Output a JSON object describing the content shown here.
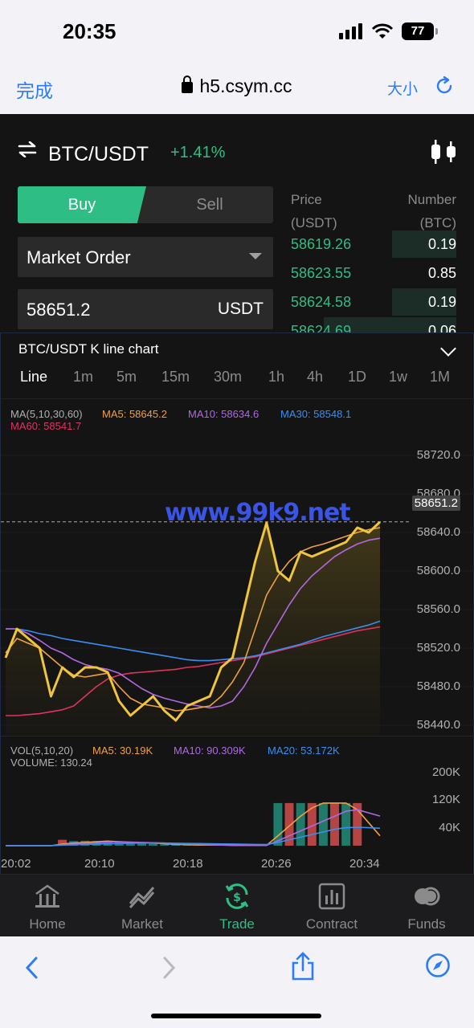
{
  "status_bar": {
    "time": "20:35",
    "battery": "77"
  },
  "browser": {
    "done_label": "完成",
    "url": "h5.csym.cc",
    "text_size_label": "大小"
  },
  "pair": {
    "name": "BTC/USDT",
    "change": "+1.41%"
  },
  "trade_form": {
    "buy_label": "Buy",
    "sell_label": "Sell",
    "order_type": "Market Order",
    "price_value": "58651.2",
    "price_unit": "USDT"
  },
  "order_book": {
    "price_header": "Price",
    "price_unit": "(USDT)",
    "number_header": "Number",
    "number_unit": "(BTC)",
    "rows": [
      {
        "price": "58619.26",
        "number": "0.19",
        "depth": 0.39
      },
      {
        "price": "58623.55",
        "number": "0.85",
        "depth": 0.0
      },
      {
        "price": "58624.58",
        "number": "0.19",
        "depth": 0.39
      },
      {
        "price": "58624.69",
        "number": "0.06",
        "depth": 0.8
      }
    ]
  },
  "chart_panel": {
    "title": "BTC/USDT K line chart",
    "periods": [
      "Line",
      "1m",
      "5m",
      "15m",
      "30m",
      "1h",
      "4h",
      "1D",
      "1w",
      "1M"
    ],
    "active_period": "Line",
    "ma_legend": {
      "label": "MA(5,10,30,60)",
      "ma5": "MA5: 58645.2",
      "ma10": "MA10: 58634.6",
      "ma30": "MA30: 58548.1",
      "ma60": "MA60: 58541.7"
    },
    "y_labels": [
      "58720.0",
      "58680.0",
      "58640.0",
      "58600.0",
      "58560.0",
      "58520.0",
      "58480.0",
      "58440.0"
    ],
    "last_price_tag": "58651.2",
    "watermark": "www.99k9.net",
    "vol_legend": {
      "label": "VOL(5,10,20)",
      "ma5": "MA5: 30.19K",
      "ma10": "MA10: 90.309K",
      "ma20": "MA20: 53.172K",
      "volume": "VOLUME: 130.24"
    },
    "vol_y_labels": [
      "200K",
      "120K",
      "40K"
    ],
    "time_labels": [
      "20:02",
      "20:10",
      "20:18",
      "20:26",
      "20:34"
    ]
  },
  "colors": {
    "up": "#2ebd85",
    "down": "#c94a4a",
    "price_line": "#f0c43c",
    "ma5": "#f0a040",
    "ma10": "#b069e0",
    "ma30": "#3a8ef0",
    "ma60": "#e0335f"
  },
  "chart_data": {
    "type": "line",
    "x": [
      "20:02",
      "20:03",
      "20:04",
      "20:05",
      "20:06",
      "20:07",
      "20:08",
      "20:09",
      "20:10",
      "20:11",
      "20:12",
      "20:13",
      "20:14",
      "20:15",
      "20:16",
      "20:17",
      "20:18",
      "20:19",
      "20:20",
      "20:21",
      "20:22",
      "20:23",
      "20:24",
      "20:25",
      "20:26",
      "20:27",
      "20:28",
      "20:29",
      "20:30",
      "20:31",
      "20:32",
      "20:33",
      "20:34",
      "20:35"
    ],
    "ylim": [
      58420,
      58740
    ],
    "series": [
      {
        "name": "price",
        "values": [
          58510,
          58540,
          58530,
          58520,
          58470,
          58500,
          58490,
          58500,
          58500,
          58495,
          58465,
          58450,
          58460,
          58470,
          58455,
          58445,
          58460,
          58465,
          58470,
          58500,
          58510,
          58560,
          58610,
          58650,
          58600,
          58590,
          58620,
          58615,
          58620,
          58625,
          58630,
          58645,
          58640,
          58651
        ]
      },
      {
        "name": "MA5",
        "values": [
          58515,
          58530,
          58525,
          58520,
          58510,
          58500,
          58492,
          58490,
          58492,
          58494,
          58480,
          58468,
          58462,
          58460,
          58458,
          58455,
          58456,
          58458,
          58460,
          58470,
          58485,
          58505,
          58540,
          58575,
          58595,
          58610,
          58620,
          58625,
          58628,
          58632,
          58636,
          58640,
          58643,
          58645
        ]
      },
      {
        "name": "MA10",
        "values": [
          58540,
          58540,
          58535,
          58528,
          58520,
          58515,
          58508,
          58503,
          58500,
          58498,
          58494,
          58486,
          58478,
          58472,
          58468,
          58465,
          58462,
          58460,
          58458,
          58460,
          58465,
          58480,
          58500,
          58525,
          58545,
          58565,
          58582,
          58595,
          58605,
          58615,
          58622,
          58628,
          58632,
          58634
        ]
      },
      {
        "name": "MA30",
        "values": [
          58540,
          58540,
          58538,
          58535,
          58533,
          58530,
          58528,
          58526,
          58524,
          58522,
          58520,
          58518,
          58516,
          58514,
          58512,
          58510,
          58508,
          58507,
          58507,
          58508,
          58509,
          58510,
          58512,
          58515,
          58518,
          58521,
          58524,
          58528,
          58532,
          58535,
          58538,
          58541,
          58544,
          58548
        ]
      },
      {
        "name": "MA60",
        "values": [
          58450,
          58450,
          58451,
          58452,
          58454,
          58456,
          58460,
          58470,
          58480,
          58488,
          58492,
          58494,
          58495,
          58496,
          58497,
          58498,
          58500,
          58501,
          58503,
          58505,
          58507,
          58509,
          58511,
          58514,
          58517,
          58520,
          58523,
          58526,
          58529,
          58532,
          58535,
          58538,
          58540,
          58542
        ]
      }
    ],
    "volume": {
      "ylim": [
        0,
        240000
      ],
      "values": [
        0,
        0,
        0,
        0,
        0,
        18000,
        14000,
        15000,
        14000,
        13000,
        10000,
        9000,
        8000,
        6000,
        4000,
        3000,
        2000,
        2000,
        1000,
        1000,
        1000,
        1000,
        0,
        0,
        130000,
        130000,
        130000,
        130000,
        130000,
        130000,
        130000,
        130000,
        0,
        0
      ],
      "up": [
        true,
        true,
        true,
        true,
        true,
        false,
        true,
        true,
        true,
        true,
        true,
        true,
        true,
        true,
        true,
        true,
        true,
        true,
        true,
        true,
        true,
        true,
        true,
        true,
        true,
        false,
        true,
        false,
        true,
        false,
        true,
        false,
        true,
        true
      ],
      "ma5": [
        0,
        0,
        0,
        0,
        0,
        5000,
        8000,
        10000,
        12000,
        14000,
        12000,
        10000,
        9000,
        8000,
        6000,
        4000,
        3000,
        2000,
        2000,
        2000,
        1000,
        1000,
        1000,
        1000,
        30000,
        60000,
        90000,
        115000,
        130000,
        130000,
        130000,
        110000,
        70000,
        30190
      ],
      "ma10": [
        0,
        0,
        0,
        0,
        0,
        3000,
        5000,
        7000,
        9000,
        11000,
        12000,
        11000,
        10000,
        9000,
        8000,
        6000,
        5000,
        4000,
        3000,
        2000,
        2000,
        2000,
        2000,
        1000,
        15000,
        30000,
        45000,
        60000,
        75000,
        90000,
        105000,
        110000,
        100000,
        90309
      ],
      "ma20": [
        0,
        0,
        0,
        0,
        0,
        1500,
        3000,
        4000,
        5000,
        6000,
        7000,
        7500,
        8000,
        8000,
        8000,
        7500,
        7000,
        6500,
        6000,
        5500,
        5000,
        4500,
        4000,
        3500,
        10000,
        18000,
        26000,
        34000,
        42000,
        50000,
        55000,
        56000,
        55000,
        53172
      ]
    }
  }
}
